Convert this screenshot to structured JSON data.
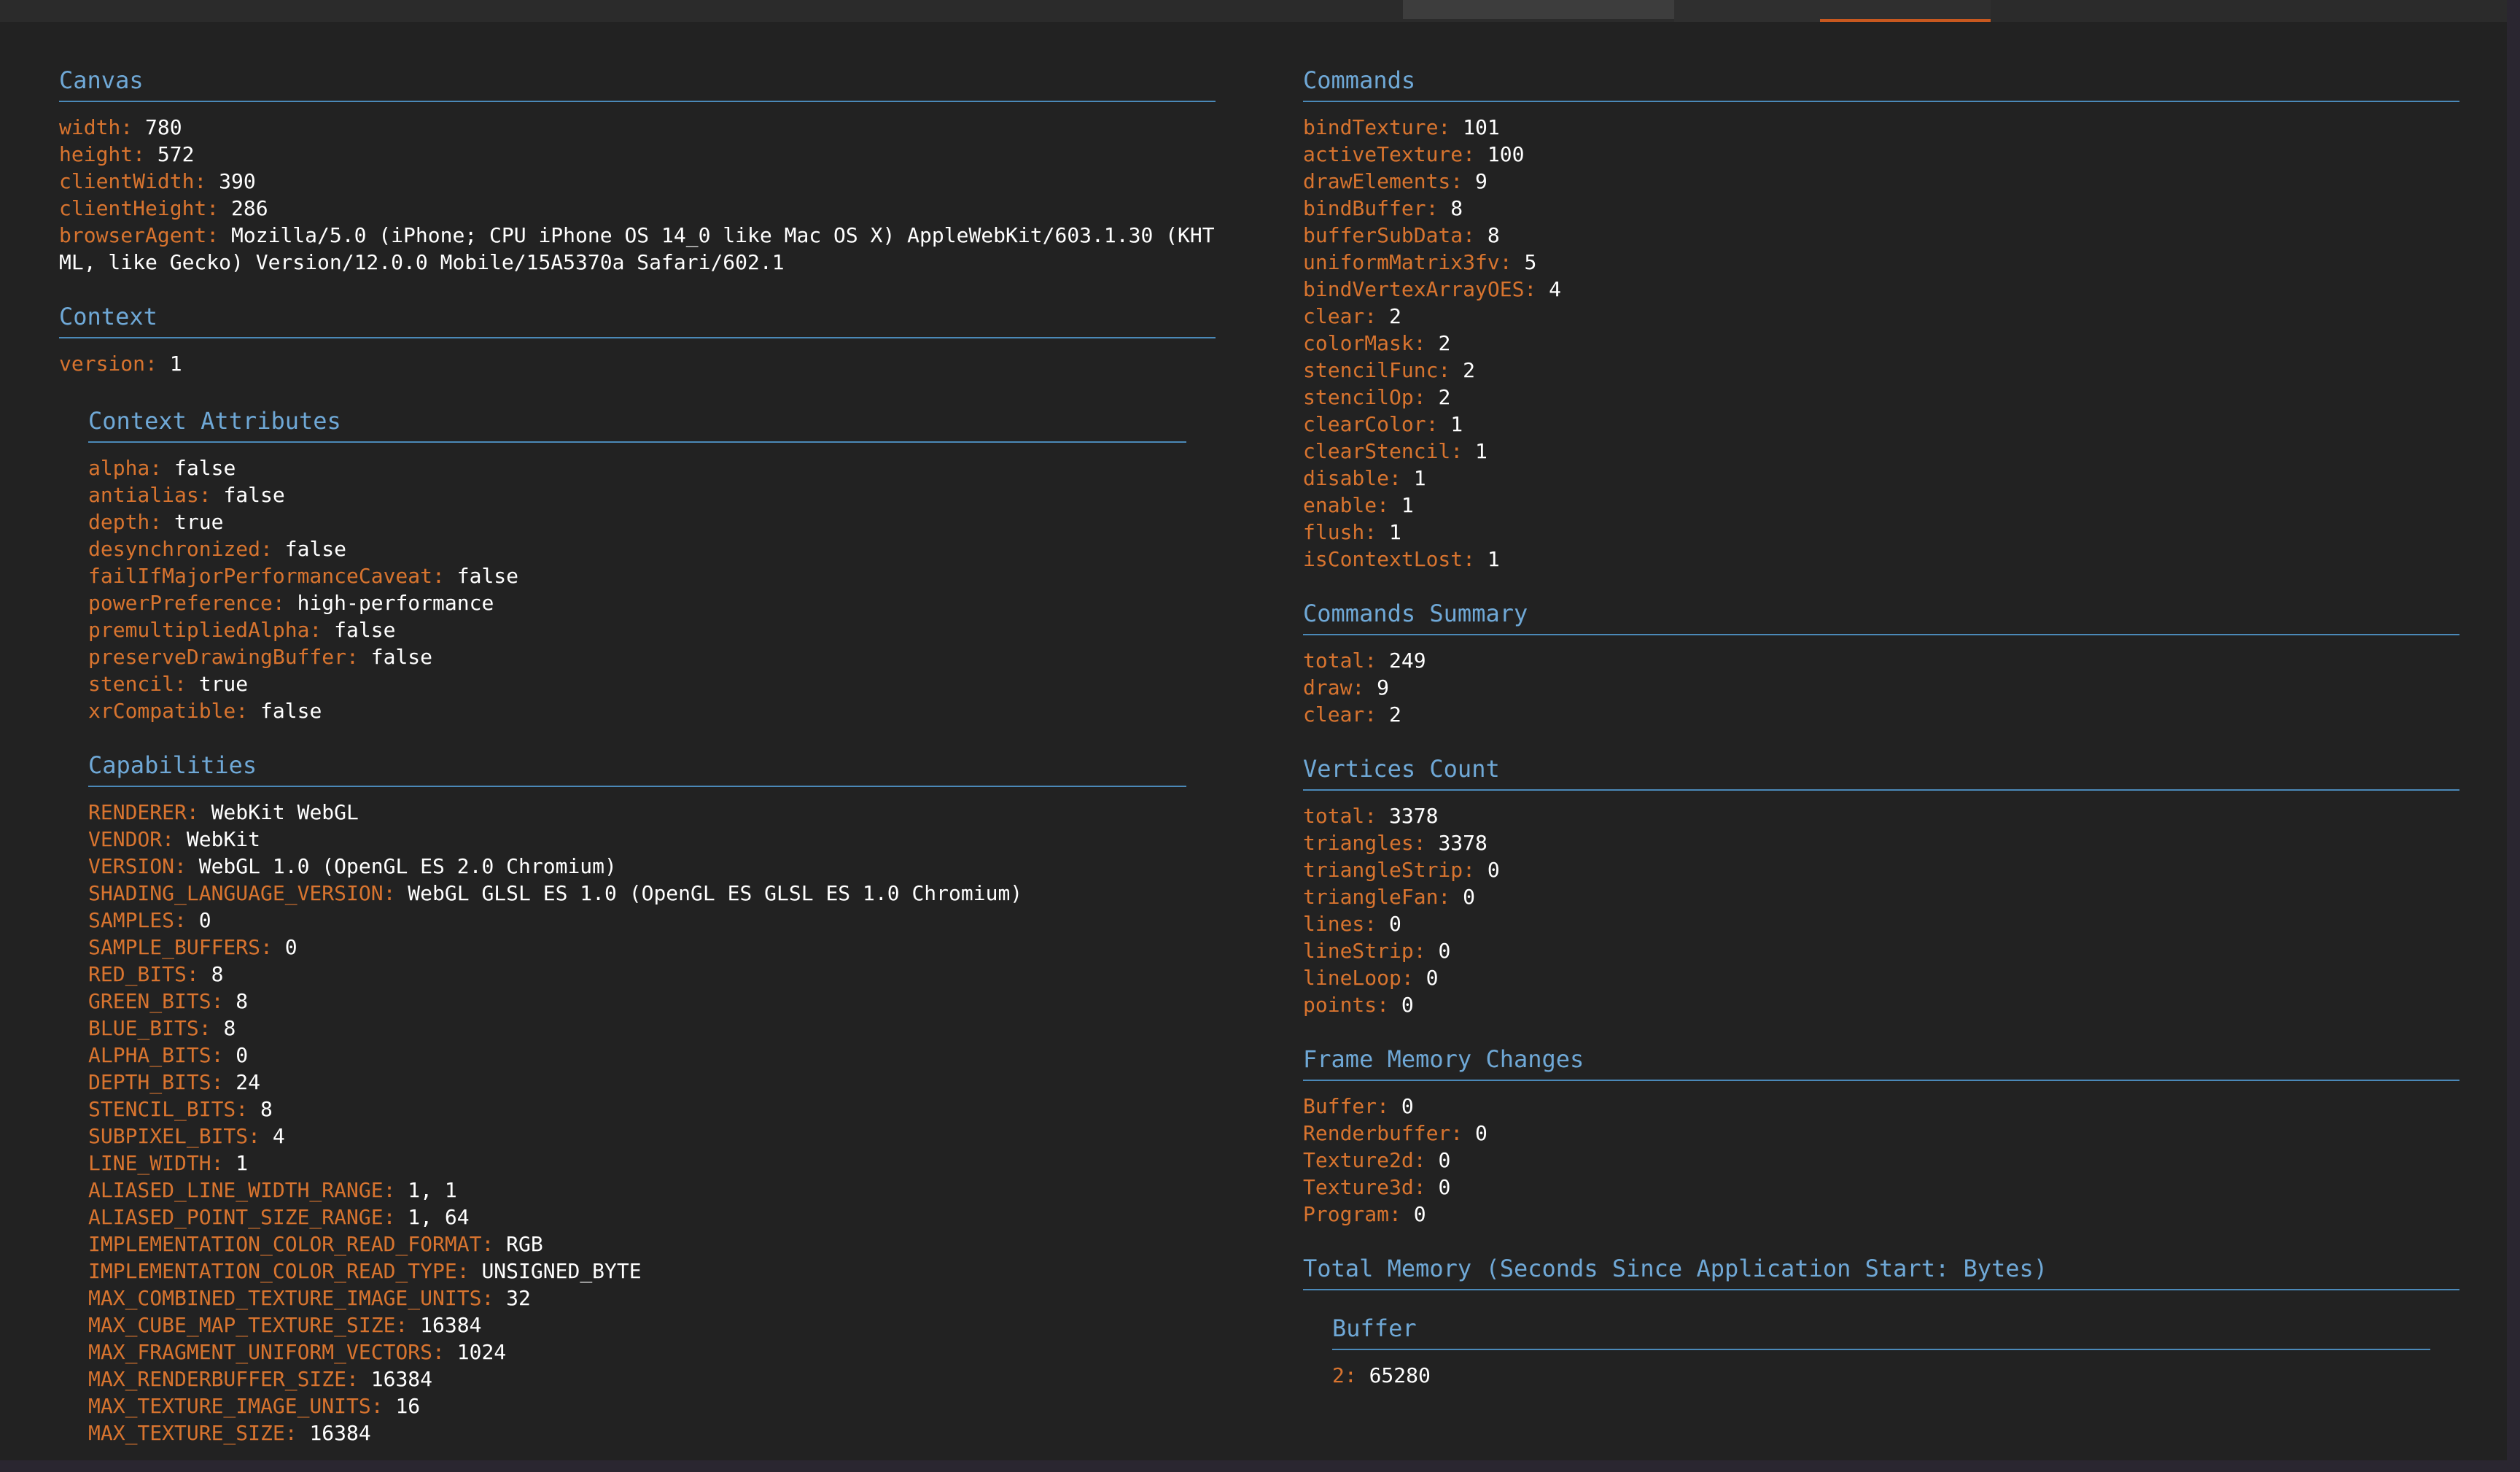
{
  "canvas": {
    "title": "Canvas",
    "fields": [
      {
        "key": "width",
        "value": "780"
      },
      {
        "key": "height",
        "value": "572"
      },
      {
        "key": "clientWidth",
        "value": "390"
      },
      {
        "key": "clientHeight",
        "value": "286"
      },
      {
        "key": "browserAgent",
        "value": "Mozilla/5.0 (iPhone; CPU iPhone OS 14_0 like Mac OS X) AppleWebKit/603.1.30 (KHTML, like Gecko) Version/12.0.0 Mobile/15A5370a Safari/602.1"
      }
    ]
  },
  "context": {
    "title": "Context",
    "fields": [
      {
        "key": "version",
        "value": "1"
      }
    ]
  },
  "context_attributes": {
    "title": "Context Attributes",
    "fields": [
      {
        "key": "alpha",
        "value": "false"
      },
      {
        "key": "antialias",
        "value": "false"
      },
      {
        "key": "depth",
        "value": "true"
      },
      {
        "key": "desynchronized",
        "value": "false"
      },
      {
        "key": "failIfMajorPerformanceCaveat",
        "value": "false"
      },
      {
        "key": "powerPreference",
        "value": "high-performance"
      },
      {
        "key": "premultipliedAlpha",
        "value": "false"
      },
      {
        "key": "preserveDrawingBuffer",
        "value": "false"
      },
      {
        "key": "stencil",
        "value": "true"
      },
      {
        "key": "xrCompatible",
        "value": "false"
      }
    ]
  },
  "capabilities": {
    "title": "Capabilities",
    "fields": [
      {
        "key": "RENDERER",
        "value": "WebKit WebGL"
      },
      {
        "key": "VENDOR",
        "value": "WebKit"
      },
      {
        "key": "VERSION",
        "value": "WebGL 1.0 (OpenGL ES 2.0 Chromium)"
      },
      {
        "key": "SHADING_LANGUAGE_VERSION",
        "value": "WebGL GLSL ES 1.0 (OpenGL ES GLSL ES 1.0 Chromium)"
      },
      {
        "key": "SAMPLES",
        "value": "0"
      },
      {
        "key": "SAMPLE_BUFFERS",
        "value": "0"
      },
      {
        "key": "RED_BITS",
        "value": "8"
      },
      {
        "key": "GREEN_BITS",
        "value": "8"
      },
      {
        "key": "BLUE_BITS",
        "value": "8"
      },
      {
        "key": "ALPHA_BITS",
        "value": "0"
      },
      {
        "key": "DEPTH_BITS",
        "value": "24"
      },
      {
        "key": "STENCIL_BITS",
        "value": "8"
      },
      {
        "key": "SUBPIXEL_BITS",
        "value": "4"
      },
      {
        "key": "LINE_WIDTH",
        "value": "1"
      },
      {
        "key": "ALIASED_LINE_WIDTH_RANGE",
        "value": "1, 1"
      },
      {
        "key": "ALIASED_POINT_SIZE_RANGE",
        "value": "1, 64"
      },
      {
        "key": "IMPLEMENTATION_COLOR_READ_FORMAT",
        "value": "RGB"
      },
      {
        "key": "IMPLEMENTATION_COLOR_READ_TYPE",
        "value": "UNSIGNED_BYTE"
      },
      {
        "key": "MAX_COMBINED_TEXTURE_IMAGE_UNITS",
        "value": "32"
      },
      {
        "key": "MAX_CUBE_MAP_TEXTURE_SIZE",
        "value": "16384"
      },
      {
        "key": "MAX_FRAGMENT_UNIFORM_VECTORS",
        "value": "1024"
      },
      {
        "key": "MAX_RENDERBUFFER_SIZE",
        "value": "16384"
      },
      {
        "key": "MAX_TEXTURE_IMAGE_UNITS",
        "value": "16"
      },
      {
        "key": "MAX_TEXTURE_SIZE",
        "value": "16384"
      }
    ]
  },
  "commands": {
    "title": "Commands",
    "fields": [
      {
        "key": "bindTexture",
        "value": "101"
      },
      {
        "key": "activeTexture",
        "value": "100"
      },
      {
        "key": "drawElements",
        "value": "9"
      },
      {
        "key": "bindBuffer",
        "value": "8"
      },
      {
        "key": "bufferSubData",
        "value": "8"
      },
      {
        "key": "uniformMatrix3fv",
        "value": "5"
      },
      {
        "key": "bindVertexArrayOES",
        "value": "4"
      },
      {
        "key": "clear",
        "value": "2"
      },
      {
        "key": "colorMask",
        "value": "2"
      },
      {
        "key": "stencilFunc",
        "value": "2"
      },
      {
        "key": "stencilOp",
        "value": "2"
      },
      {
        "key": "clearColor",
        "value": "1"
      },
      {
        "key": "clearStencil",
        "value": "1"
      },
      {
        "key": "disable",
        "value": "1"
      },
      {
        "key": "enable",
        "value": "1"
      },
      {
        "key": "flush",
        "value": "1"
      },
      {
        "key": "isContextLost",
        "value": "1"
      }
    ]
  },
  "commands_summary": {
    "title": "Commands Summary",
    "fields": [
      {
        "key": "total",
        "value": "249"
      },
      {
        "key": "draw",
        "value": "9"
      },
      {
        "key": "clear",
        "value": "2"
      }
    ]
  },
  "vertices_count": {
    "title": "Vertices Count",
    "fields": [
      {
        "key": "total",
        "value": "3378"
      },
      {
        "key": "triangles",
        "value": "3378"
      },
      {
        "key": "triangleStrip",
        "value": "0"
      },
      {
        "key": "triangleFan",
        "value": "0"
      },
      {
        "key": "lines",
        "value": "0"
      },
      {
        "key": "lineStrip",
        "value": "0"
      },
      {
        "key": "lineLoop",
        "value": "0"
      },
      {
        "key": "points",
        "value": "0"
      }
    ]
  },
  "frame_memory_changes": {
    "title": "Frame Memory Changes",
    "fields": [
      {
        "key": "Buffer",
        "value": "0"
      },
      {
        "key": "Renderbuffer",
        "value": "0"
      },
      {
        "key": "Texture2d",
        "value": "0"
      },
      {
        "key": "Texture3d",
        "value": "0"
      },
      {
        "key": "Program",
        "value": "0"
      }
    ]
  },
  "total_memory": {
    "title": "Total Memory (Seconds Since Application Start: Bytes)"
  },
  "buffer": {
    "title": "Buffer",
    "fields": [
      {
        "key": "2",
        "value": "65280"
      }
    ]
  },
  "separator": ": ",
  "colors": {
    "key": "#d8742f",
    "title": "#6fa8d6",
    "rule": "#4b89b8",
    "background": "#222222",
    "accent_tab": "#c8581f"
  }
}
